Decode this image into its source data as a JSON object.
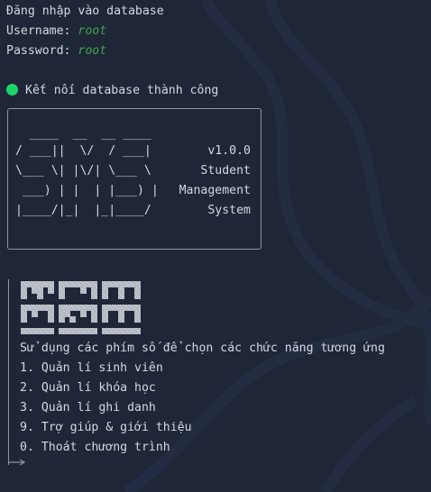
{
  "header": {
    "login_title": "Đăng nhập vào database",
    "username_label": "Username:",
    "username_value": "root",
    "password_label": "Password:",
    "password_value": "root"
  },
  "status": {
    "message": "Kết nối database thành công",
    "color": "#1fd36b"
  },
  "banner": {
    "ascii_lines": [
      "  ____  __  __ ____",
      "/ ___||  \\/  / ___|",
      "\\___ \\| |\\/| \\___ \\",
      " ___) | |  | |___) |",
      "|____/|_|  |_|____/"
    ],
    "version": "v1.0.0",
    "subtitle_lines": [
      "Student",
      "Management",
      "System"
    ]
  },
  "menu": {
    "prompt": "Sử dụng các phím số để chọn các chức năng tương ứng",
    "items": [
      "1. Quản lí sinh viên",
      "2. Quản lí khóa học",
      "3. Quản lí ghi danh",
      "9. Trợ giúp & giới thiệu",
      "0. Thoát chương trình"
    ]
  },
  "colors": {
    "background": "#1f2638",
    "text": "#d5d8df",
    "accent_green": "#3fa64a",
    "status_green": "#1fd36b"
  },
  "icons": {
    "status": "status-dot-icon",
    "logo": "pixel-logo-icon",
    "prompt": "prompt-arrow-icon"
  }
}
